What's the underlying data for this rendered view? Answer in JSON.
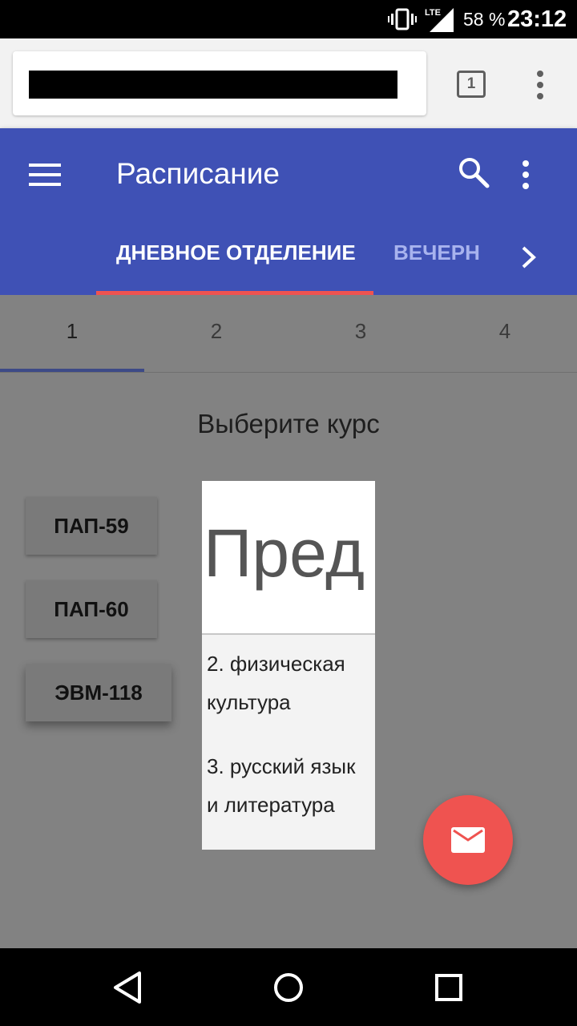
{
  "status_bar": {
    "network": "LTE",
    "battery": "58 %",
    "time": "23:12"
  },
  "browser": {
    "tab_count": "1"
  },
  "app_bar": {
    "title": "Расписание",
    "tabs": [
      {
        "label": "ДНЕВНОЕ ОТДЕЛЕНИЕ",
        "active": true
      },
      {
        "label": "ВЕЧЕРНЕЕ ОТДЕЛЕНИЕ",
        "active": false
      }
    ],
    "accent_color": "#3f51b5",
    "indicator_color": "#ef5350"
  },
  "subtabs": [
    {
      "label": "1",
      "active": true
    },
    {
      "label": "2",
      "active": false
    },
    {
      "label": "3",
      "active": false
    },
    {
      "label": "4",
      "active": false
    }
  ],
  "prompt": "Выберите курс",
  "courses": [
    "ПАП-59",
    "ПАП-60",
    "ЭВМ-118"
  ],
  "card": {
    "header": "Пред",
    "items": [
      "2. физическая культура",
      "3. русский язык и литература"
    ]
  },
  "fab": {
    "icon": "mail-icon",
    "color": "#ef5350"
  }
}
